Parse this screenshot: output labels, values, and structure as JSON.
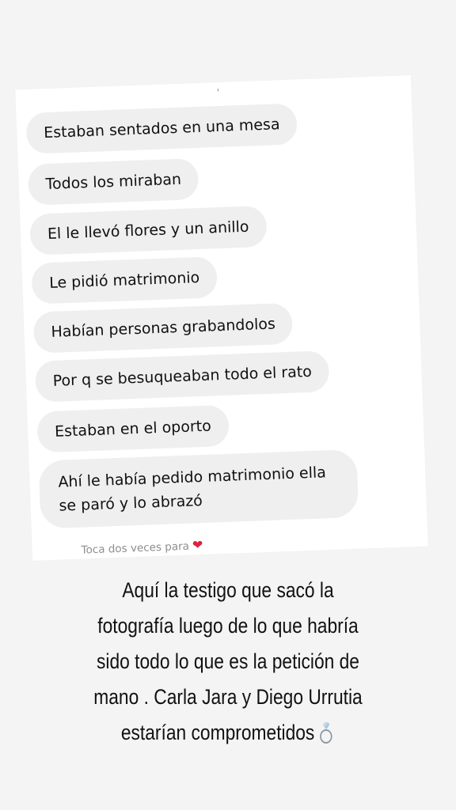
{
  "conversation": {
    "top_fragment": ",",
    "messages": [
      "Estaban sentados en una mesa",
      "Todos los miraban",
      "El le llevó flores y un anillo",
      "Le pidió matrimonio",
      "Habían personas grabandolos",
      "Por q se besuqueaban todo el rato",
      "Estaban en el oporto",
      "Ahí le había pedido matrimonio ella se paró y lo abrazó"
    ],
    "reaction_hint": "Toca dos veces para",
    "reaction_icon": "heart-icon",
    "reaction_color": "#e0213f"
  },
  "caption": {
    "lines": [
      "Aquí la testigo que sacó la",
      "fotografía luego de lo que habría",
      "sido todo lo que es la petición de",
      "mano . Carla Jara y Diego Urrutia",
      "estarían comprometidos"
    ],
    "end_icon": "ring-icon"
  },
  "colors": {
    "background": "#f4f4f4",
    "bubble": "#efefef",
    "hint_text": "#8e8e8e"
  }
}
